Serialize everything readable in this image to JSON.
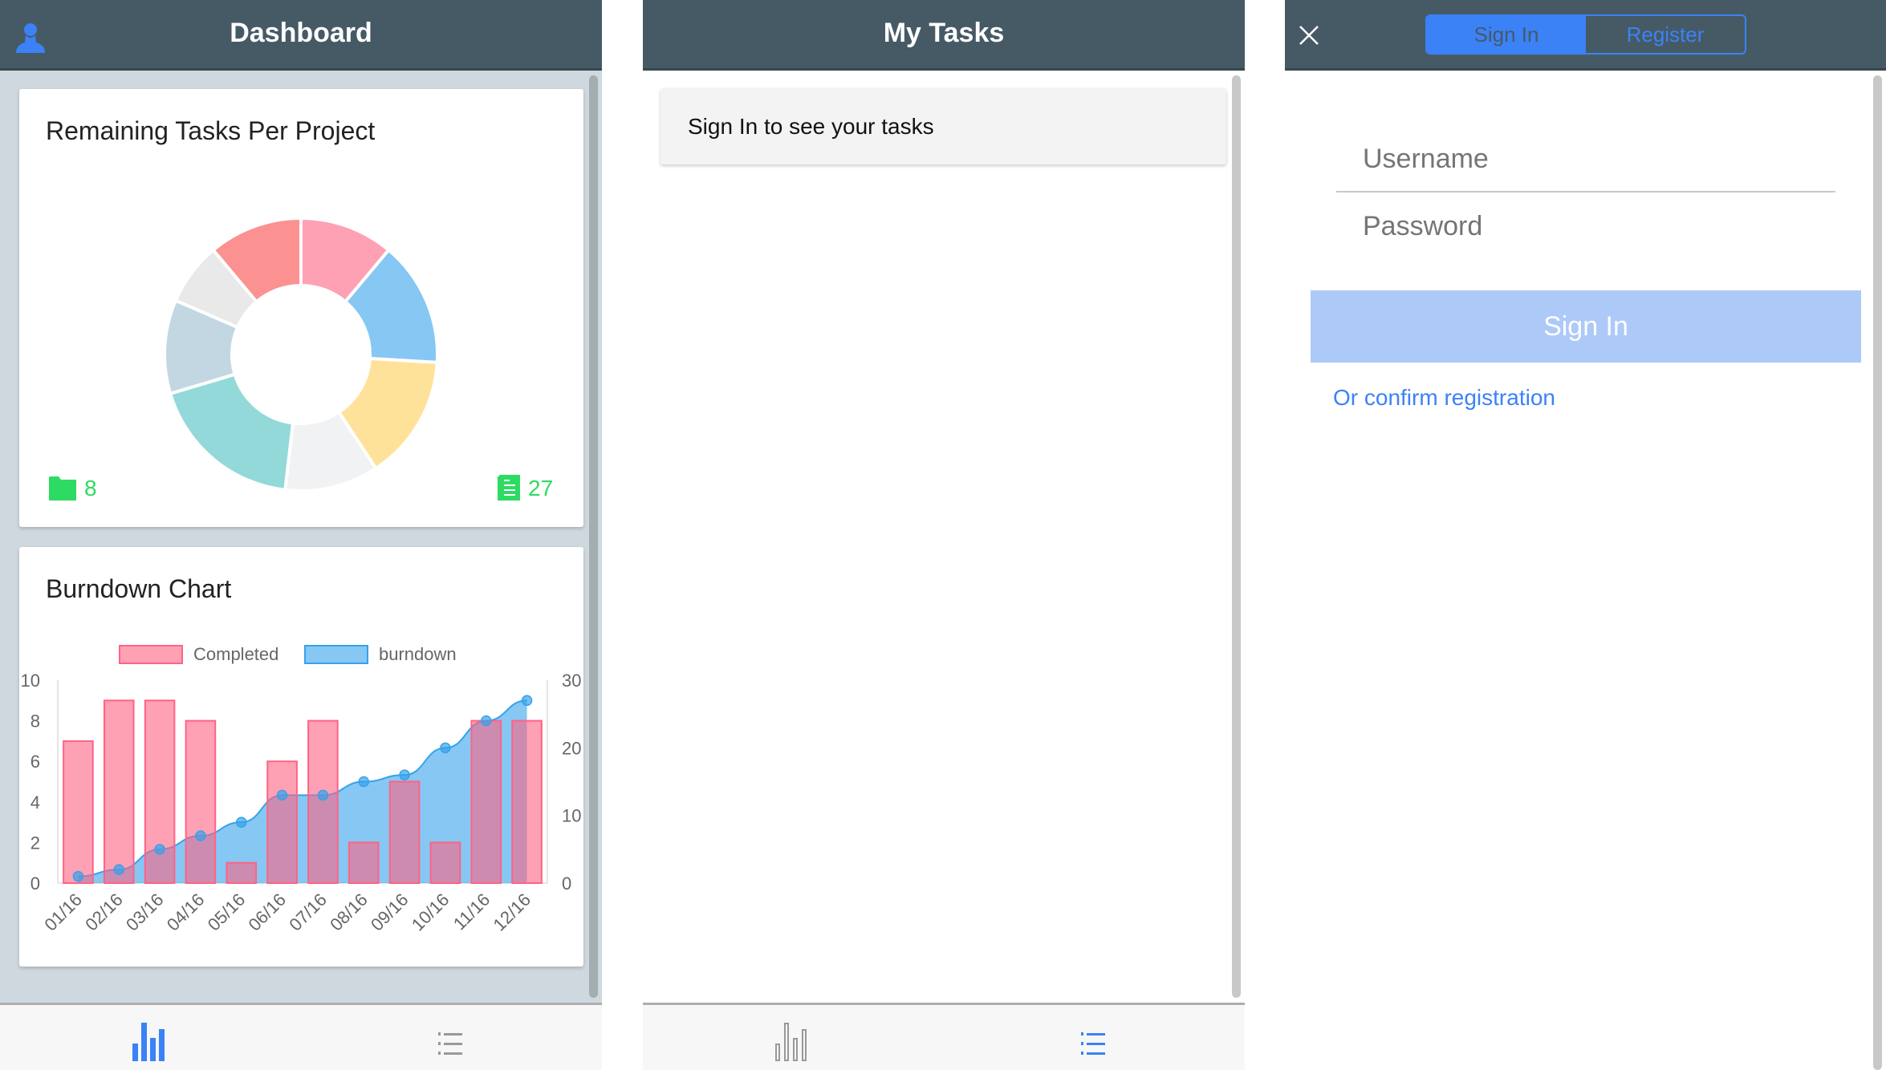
{
  "dashboard": {
    "title": "Dashboard",
    "pie_card": {
      "title": "Remaining Tasks Per Project",
      "projects_count": "8",
      "tasks_count": "27"
    },
    "burndown_card": {
      "title": "Burndown Chart"
    }
  },
  "tasks": {
    "title": "My Tasks",
    "message": "Sign In to see your tasks"
  },
  "auth": {
    "tabs": [
      {
        "label": "Sign In",
        "active": true
      },
      {
        "label": "Register",
        "active": false
      }
    ],
    "username_placeholder": "Username",
    "password_placeholder": "Password",
    "submit_label": "Sign In",
    "confirm_link": "Or confirm registration"
  },
  "colors": {
    "header": "#465a66",
    "accent": "#3b82f6",
    "green": "#2edb62"
  },
  "chart_data": [
    {
      "type": "pie",
      "variant": "doughnut",
      "values": [
        3,
        4,
        4,
        3,
        5,
        3,
        2,
        3
      ],
      "colors": [
        "#ffa1b5",
        "#86c7f3",
        "#ffe29a",
        "#f1f2f4",
        "#93d9d9",
        "#c2d7e2",
        "#e9e9e9",
        "#fb9191"
      ]
    },
    {
      "type": "bar+area",
      "legend": "top",
      "categories": [
        "01/16",
        "02/16",
        "03/16",
        "04/16",
        "05/16",
        "06/16",
        "07/16",
        "08/16",
        "09/16",
        "10/16",
        "11/16",
        "12/16"
      ],
      "series": [
        {
          "name": "Completed",
          "type": "bar",
          "axis": "left",
          "values": [
            7,
            9,
            9,
            8,
            1,
            6,
            8,
            2,
            5,
            2,
            8,
            8
          ],
          "color": "#ff6384"
        },
        {
          "name": "burndown",
          "type": "area",
          "axis": "right",
          "values": [
            1,
            2,
            5,
            7,
            9,
            13,
            13,
            15,
            16,
            20,
            24,
            27
          ],
          "color": "#36a2eb"
        }
      ],
      "y_left": {
        "range": [
          0,
          10
        ],
        "ticks": [
          "0",
          "2",
          "4",
          "6",
          "8",
          "10"
        ]
      },
      "y_right": {
        "range": [
          0,
          30
        ],
        "ticks": [
          "0",
          "10",
          "20",
          "30"
        ]
      }
    }
  ]
}
